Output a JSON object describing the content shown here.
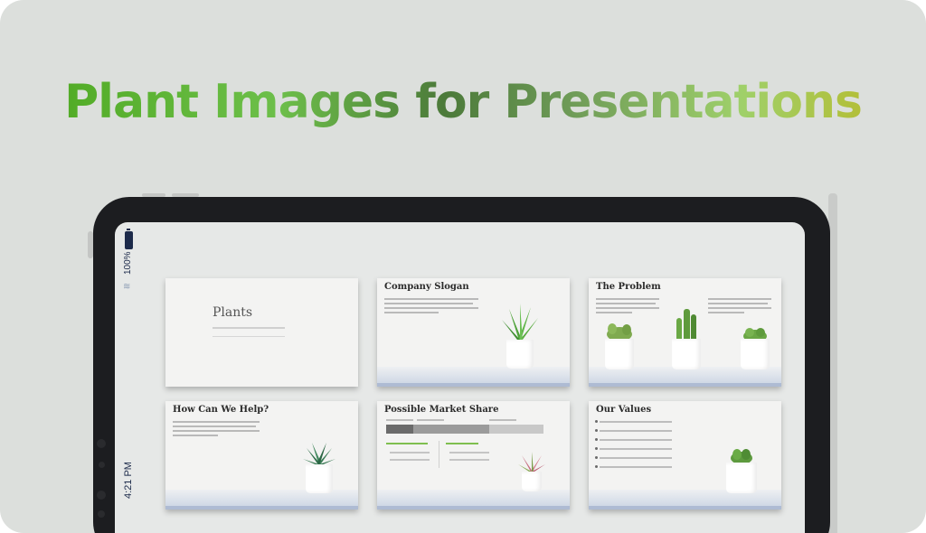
{
  "headline": "Plant Images for Presentations",
  "status_bar": {
    "battery": "100%",
    "time": "4:21 PM"
  },
  "slides": [
    {
      "title": "Plants"
    },
    {
      "title": "Company Slogan"
    },
    {
      "title": "The Problem"
    },
    {
      "title": "How Can We Help?"
    },
    {
      "title": "Possible Market Share"
    },
    {
      "title": "Our Values"
    }
  ],
  "colors": {
    "background": "#dcdfdc",
    "headline_start": "#4aa61c",
    "headline_end": "#bdb61f",
    "tablet_bezel": "#1c1d20",
    "screen": "#e6e8e7"
  },
  "icons": {
    "battery": "battery-icon",
    "wifi": "wifi-icon"
  }
}
